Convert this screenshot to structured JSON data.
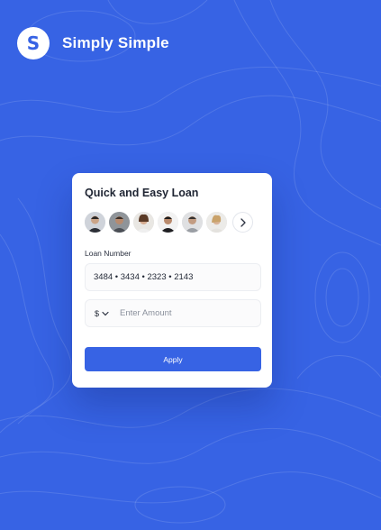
{
  "brand": {
    "logo_letter": "S",
    "name": "Simply Simple"
  },
  "card": {
    "title": "Quick and Easy Loan",
    "avatars": [
      {
        "name": "person-1"
      },
      {
        "name": "person-2"
      },
      {
        "name": "person-3"
      },
      {
        "name": "person-4"
      },
      {
        "name": "person-5"
      },
      {
        "name": "person-6"
      }
    ],
    "loan_label": "Loan Number",
    "loan_number": "3484 • 3434 • 2323 • 2143",
    "currency": "$",
    "amount_placeholder": "Enter Amount",
    "apply_label": "Apply"
  },
  "colors": {
    "accent": "#3763e4",
    "card": "#ffffff",
    "text": "#1f2533"
  }
}
